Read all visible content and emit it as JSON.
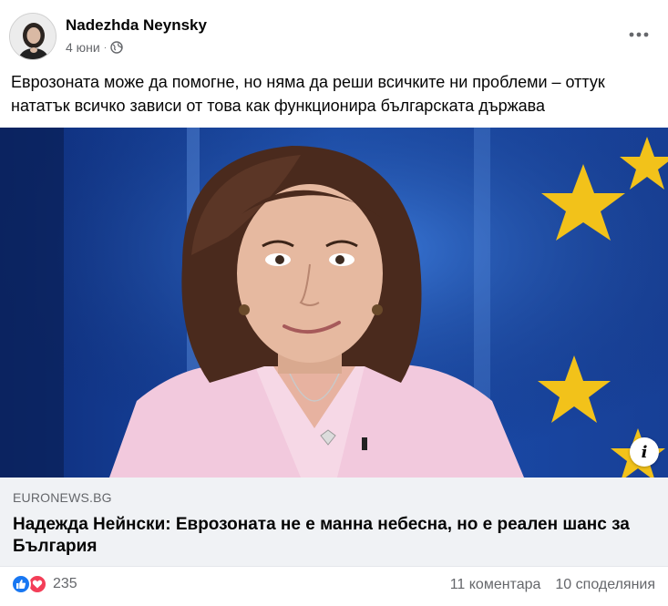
{
  "post": {
    "author": "Nadezhda Neynsky",
    "date": "4 юни",
    "privacy_icon": "globe-icon",
    "text": "Еврозоната може да помогне, но няма да реши всичките ни проблеми – оттук нататък всичко зависи от това как функционира българската държава"
  },
  "link_preview": {
    "domain": "EURONEWS.BG",
    "title": "Надежда Нейнски: Еврозоната не е манна небесна, но е реален шанс за България",
    "info_icon": "i"
  },
  "footer": {
    "reaction_count": "235",
    "comments": "11 коментара",
    "shares": "10 споделяния"
  },
  "colors": {
    "like": "#1877f2",
    "love": "#f33e58",
    "link_bg": "#f0f2f5",
    "muted_text": "#65676b"
  }
}
